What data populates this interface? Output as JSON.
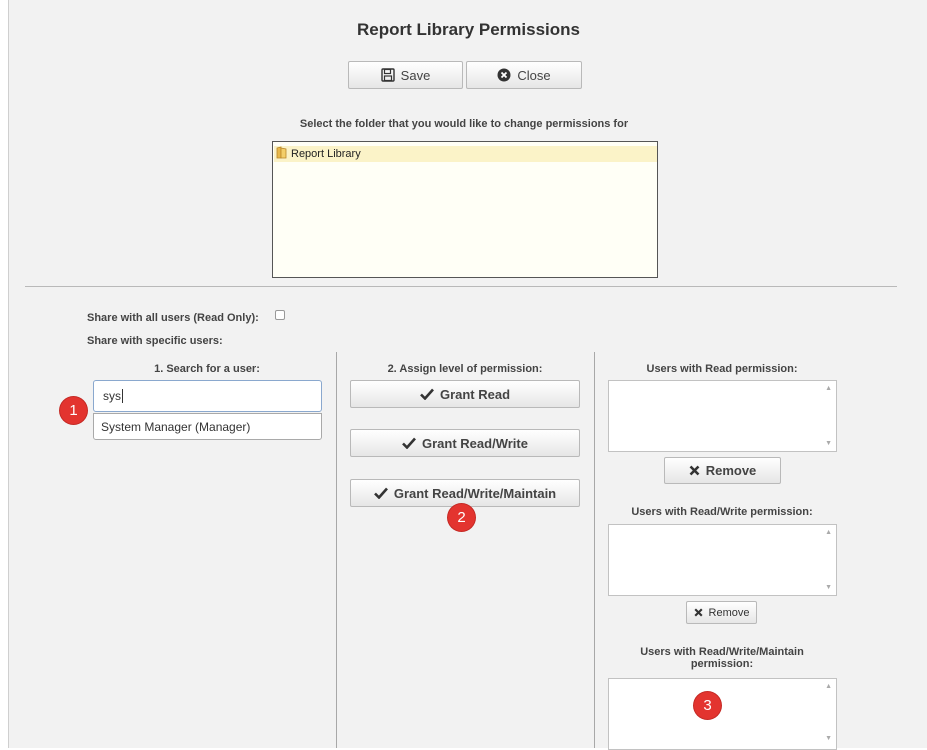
{
  "title": "Report Library Permissions",
  "toolbar": {
    "save_label": "Save",
    "close_label": "Close"
  },
  "folder_prompt": "Select the folder that you would like to change permissions for",
  "folder_tree": {
    "items": [
      {
        "label": "Report Library",
        "selected": true
      }
    ]
  },
  "share_all_label": "Share with all users (Read Only):",
  "share_all_checked": false,
  "share_specific_label": "Share with specific users:",
  "search": {
    "heading": "1. Search for a user:",
    "value": "sys",
    "suggestion": "System Manager (Manager)"
  },
  "assign": {
    "heading": "2. Assign level of permission:",
    "grant_read": "Grant Read",
    "grant_read_write": "Grant Read/Write",
    "grant_read_write_maintain": "Grant Read/Write/Maintain"
  },
  "permissions": {
    "read_heading": "Users with Read permission:",
    "read_write_heading": "Users with Read/Write permission:",
    "read_write_maintain_heading": "Users with Read/Write/Maintain permission:",
    "remove_label": "Remove"
  },
  "badges": [
    "1",
    "2",
    "3"
  ],
  "colors": {
    "badge": "#e3342f",
    "folder_selected": "#fbf3c8",
    "input_focus_border": "#8aa8ce"
  }
}
